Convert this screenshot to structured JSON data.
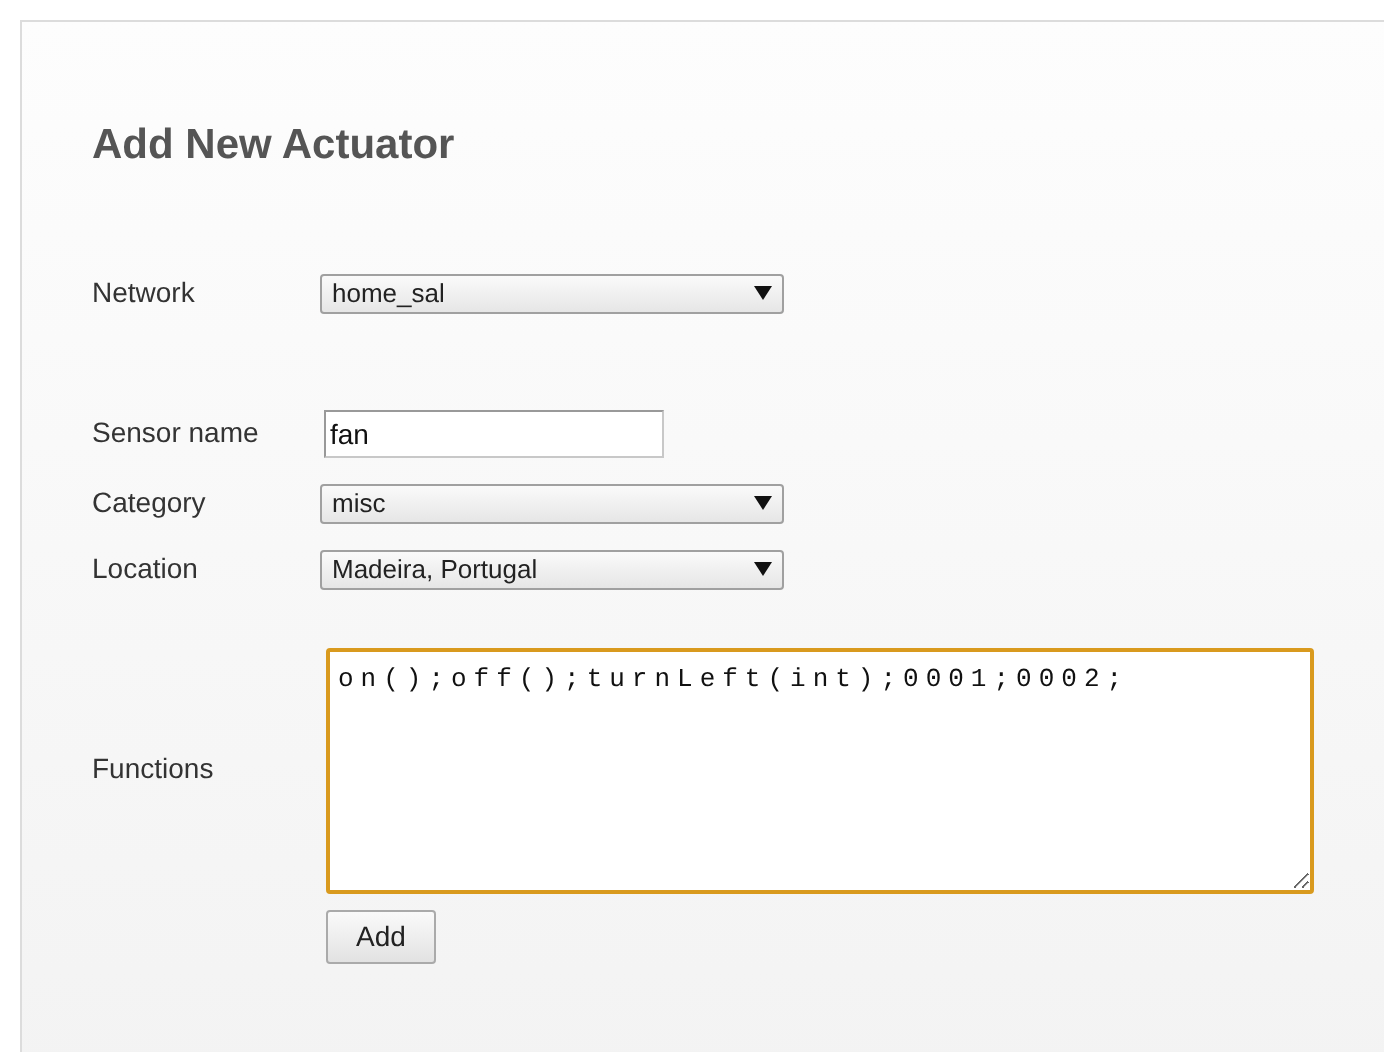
{
  "title": "Add New Actuator",
  "fields": [
    {
      "kind": "select",
      "label": "Network",
      "value": "home_sal"
    },
    {
      "kind": "text",
      "label": "Sensor name",
      "value": "fan"
    },
    {
      "kind": "select",
      "label": "Category",
      "value": "misc"
    },
    {
      "kind": "select",
      "label": "Location",
      "value": "Madeira, Portugal"
    },
    {
      "kind": "textarea",
      "label": "Functions",
      "value": "on();off();turnLeft(int);0001;0002;",
      "focused": true
    }
  ],
  "button": "Add"
}
